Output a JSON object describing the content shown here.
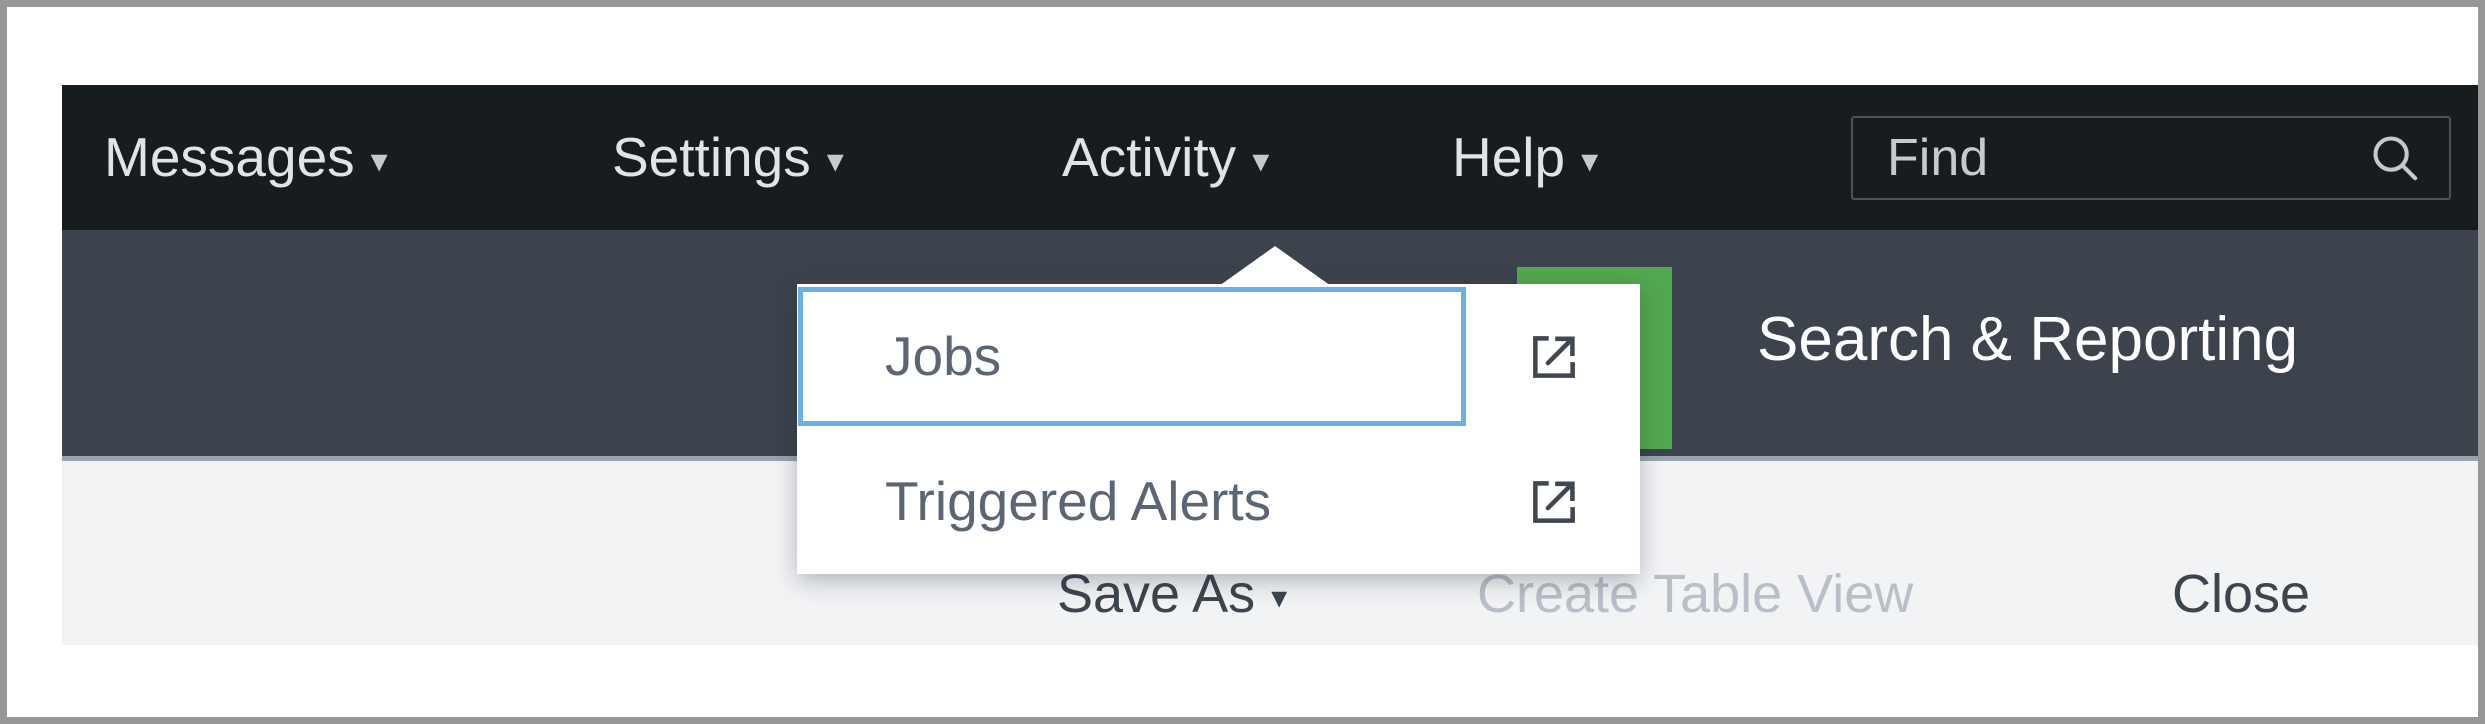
{
  "app": {
    "name": "Search & Reporting",
    "accent_color": "#53a84f",
    "navbar_color": "#171c1f",
    "subbar_color": "#3c434d",
    "toolbar_color": "#f2f3f5",
    "focus_ring_color": "#6ab1e0"
  },
  "navbar": {
    "items": [
      {
        "label": "Messages",
        "caret": "▾"
      },
      {
        "label": "Settings",
        "caret": "▾"
      },
      {
        "label": "Activity",
        "caret": "▾"
      },
      {
        "label": "Help",
        "caret": "▾"
      }
    ],
    "find": {
      "placeholder": "Find",
      "value": "Find",
      "icon": "search-icon"
    }
  },
  "dropdown": {
    "owner": "Activity",
    "items": [
      {
        "label": "Jobs",
        "icon": "external-link-icon",
        "focused": true
      },
      {
        "label": "Triggered Alerts",
        "icon": "external-link-icon",
        "focused": false
      }
    ]
  },
  "toolbar": {
    "save_as_label": "Save As",
    "save_as_caret": "▾",
    "create_table_view_label": "Create Table View",
    "close_label": "Close"
  }
}
